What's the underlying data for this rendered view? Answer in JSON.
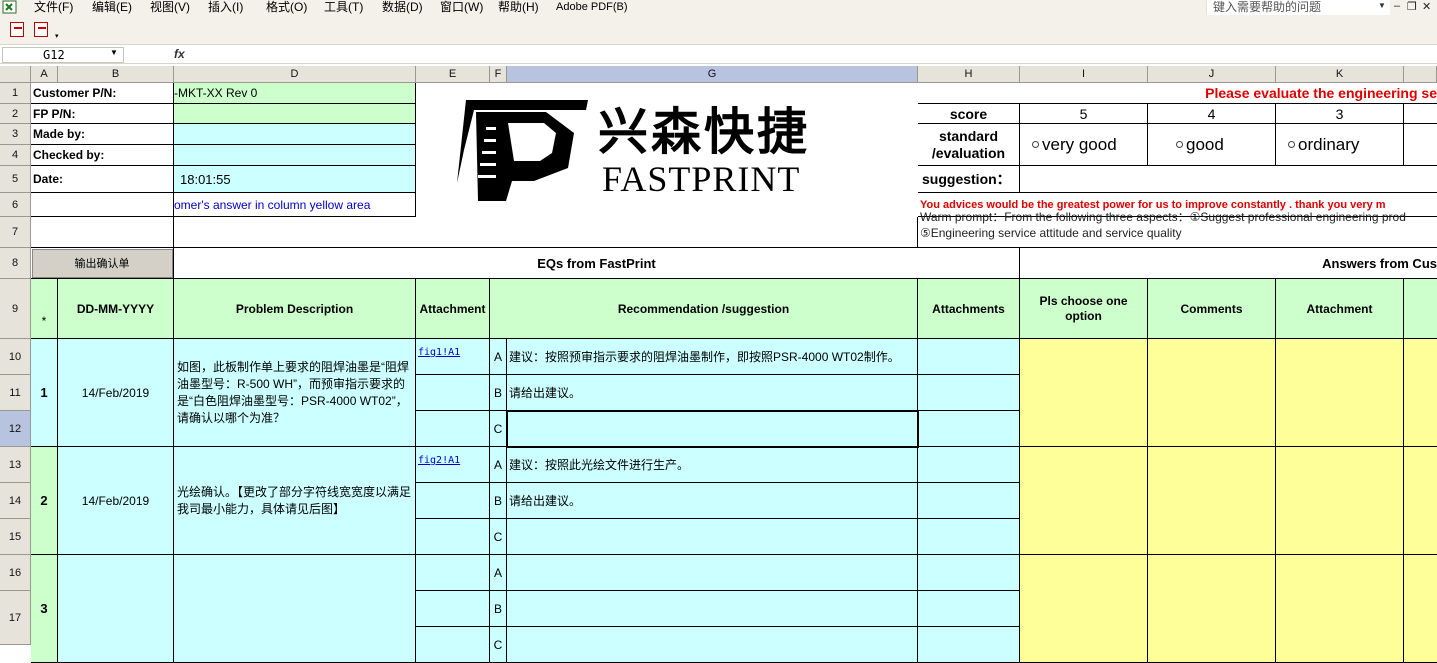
{
  "menu": {
    "items": [
      "文件(F)",
      "编辑(E)",
      "视图(V)",
      "插入(I)",
      "格式(O)",
      "工具(T)",
      "数据(D)",
      "窗口(W)",
      "帮助(H)",
      "Adobe PDF(B)"
    ],
    "help_placeholder": "键入需要帮助的问题"
  },
  "formula": {
    "cell_ref": "G12",
    "fx": "fx",
    "value": ""
  },
  "columns": [
    "A",
    "B",
    "D",
    "E",
    "F",
    "G",
    "H",
    "I",
    "J",
    "K"
  ],
  "rows": [
    "1",
    "2",
    "3",
    "4",
    "5",
    "6",
    "7",
    "8",
    "9",
    "10",
    "11",
    "12",
    "13",
    "14",
    "15",
    "16",
    "17"
  ],
  "header_form": {
    "customer_pn_label": "Customer P/N:",
    "customer_pn_value": "-MKT-XX Rev 0",
    "fp_pn_label": "FP P/N:",
    "made_by_label": "Made by:",
    "checked_by_label": "Checked by:",
    "date_label": "Date:",
    "date_value": "18:01:55",
    "answer_note": "omer's  answer in column yellow area"
  },
  "logo": {
    "chinese": "兴森快捷",
    "english": "FASTPRINT"
  },
  "evaluation": {
    "title": "Please evaluate the engineering se",
    "score_label": "score",
    "scores": [
      "5",
      "4",
      "3"
    ],
    "standard_label_1": "standard",
    "standard_label_2": "/evaluation",
    "options": [
      "very good",
      "good",
      "ordinary"
    ],
    "suggestion_label": "suggestion：",
    "advice_text": "You advices would be the greatest power for us to improve constantly .  thank you very m",
    "warm_prompt": "Warm prompt：From the following three aspects：①Suggest professional engineering prod",
    "service_text": "⑤Engineering service attitude and service quality"
  },
  "section": {
    "button_label": "输出确认单",
    "eqs_title": "EQs from FastPrint",
    "answers_title": "Answers from Cus"
  },
  "table_headers": {
    "star": "*",
    "date": "DD-MM-YYYY",
    "problem": "Problem Description",
    "attachment": "Attachment",
    "recommendation": "Recommendation /suggestion",
    "attachments": "Attachments",
    "choose": "Pls choose one option",
    "comments": "Comments",
    "attachment2": "Attachment"
  },
  "eq_rows": [
    {
      "num": "1",
      "date": "14/Feb/2019",
      "problem": "如图，此板制作单上要求的阻焊油墨是“阻焊油墨型号：R-500 WH”，而预审指示要求的是“白色阻焊油墨型号：PSR-4000 WT02”，请确认以哪个为准？",
      "link": "fig1!A1",
      "options": [
        {
          "letter": "A",
          "text": "建议：按照预审指示要求的阻焊油墨制作，即按照PSR-4000 WT02制作。"
        },
        {
          "letter": "B",
          "text": "请给出建议。"
        },
        {
          "letter": "C",
          "text": ""
        }
      ]
    },
    {
      "num": "2",
      "date": "14/Feb/2019",
      "problem": "光绘确认。【更改了部分字符线宽宽度以满足我司最小能力，具体请见后图】",
      "link": "fig2!A1",
      "options": [
        {
          "letter": "A",
          "text": "建议：按照此光绘文件进行生产。"
        },
        {
          "letter": "B",
          "text": "请给出建议。"
        },
        {
          "letter": "C",
          "text": ""
        }
      ]
    },
    {
      "num": "3",
      "date": "",
      "problem": "",
      "link": "",
      "options": [
        {
          "letter": "A",
          "text": ""
        },
        {
          "letter": "B",
          "text": ""
        },
        {
          "letter": "C",
          "text": ""
        }
      ]
    }
  ],
  "colors": {
    "green": "#ccffcc",
    "cyan": "#ccffff",
    "yellow": "#ffff99",
    "red": "#e00000",
    "blue": "#0000cc"
  }
}
